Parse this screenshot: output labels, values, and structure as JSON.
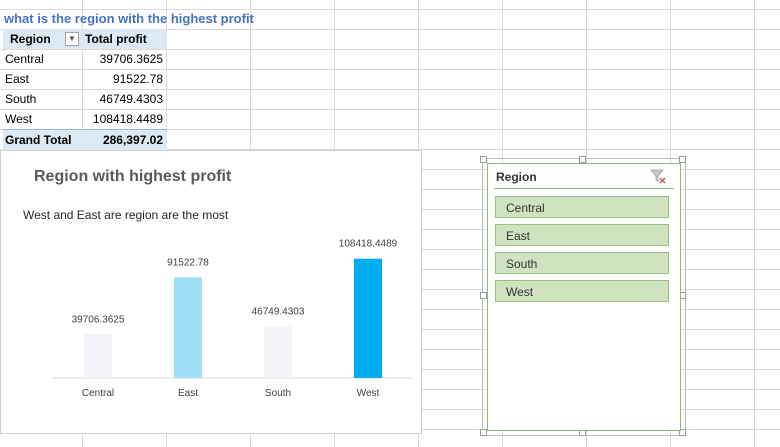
{
  "question": "what is the region with the highest profit",
  "pivot": {
    "header": {
      "col1": "Region",
      "col2": "Total profit"
    },
    "rows": [
      {
        "label": "Central",
        "value": "39706.3625"
      },
      {
        "label": "East",
        "value": "91522.78"
      },
      {
        "label": "South",
        "value": "46749.4303"
      },
      {
        "label": "West",
        "value": "108418.4489"
      }
    ],
    "total": {
      "label": "Grand Total",
      "value": "286,397.02"
    }
  },
  "chart": {
    "title": "Region with highest profit",
    "subtitle": "West and East are region are the most"
  },
  "chart_data": {
    "type": "bar",
    "title": "Region with highest profit",
    "categories": [
      "Central",
      "East",
      "South",
      "West"
    ],
    "values": [
      39706.3625,
      91522.78,
      46749.4303,
      108418.4489
    ],
    "data_labels": [
      "39706.3625",
      "91522.78",
      "46749.4303",
      "108418.4489"
    ],
    "colors": [
      "#f2f4f7",
      "#9edff7",
      "#f2f4f7",
      "#00aeef"
    ],
    "ylim": [
      0,
      120000
    ],
    "xlabel": "",
    "ylabel": "",
    "grid": false
  },
  "slicer": {
    "title": "Region",
    "clear_icon": "clear-filter-icon",
    "items": [
      "Central",
      "East",
      "South",
      "West"
    ],
    "accent": "#cfe3be"
  }
}
